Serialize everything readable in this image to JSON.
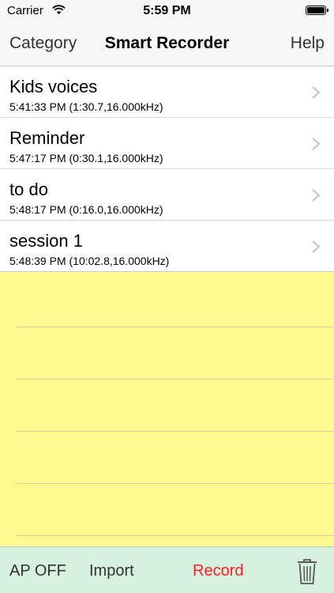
{
  "status": {
    "carrier": "Carrier",
    "time": "5:59 PM"
  },
  "nav": {
    "left": "Category",
    "title": "Smart Recorder",
    "right": "Help"
  },
  "recordings": [
    {
      "name": "Kids voices",
      "meta": "5:41:33 PM (1:30.7,16.000kHz)"
    },
    {
      "name": "Reminder",
      "meta": "5:47:17 PM (0:30.1,16.000kHz)"
    },
    {
      "name": "to do",
      "meta": "5:48:17 PM (0:16.0,16.000kHz)"
    },
    {
      "name": "session 1",
      "meta": "5:48:39 PM (10:02.8,16.000kHz)"
    }
  ],
  "toolbar": {
    "ap": "AP OFF",
    "import": "Import",
    "record": "Record",
    "trash_icon": "trash-icon"
  },
  "colors": {
    "notepad": "#fffa8f",
    "toolbar": "#d6f0e0",
    "record": "#ff1f1f"
  }
}
